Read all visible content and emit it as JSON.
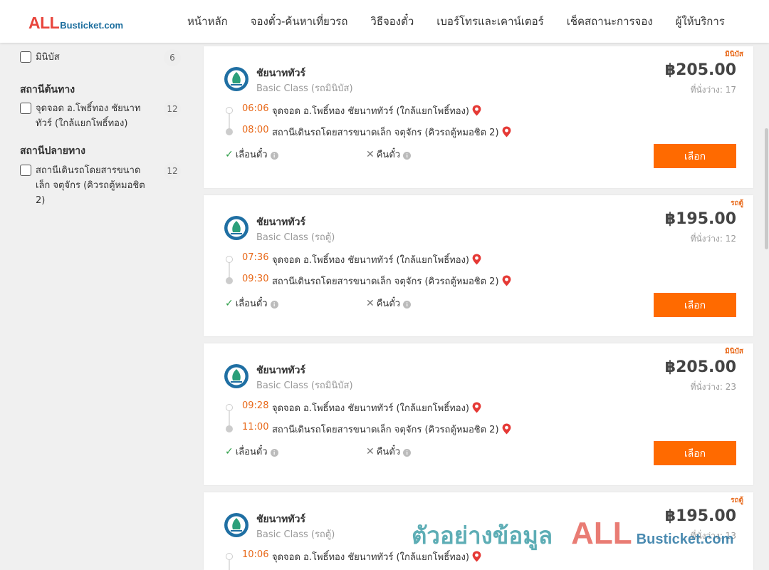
{
  "header": {
    "logo_all": "ALL",
    "logo_busticket": "Busticket.com",
    "nav": [
      {
        "label": "หน้าหลัก"
      },
      {
        "label": "จองตั๋ว-ค้นหาเที่ยวรถ"
      },
      {
        "label": "วิธีจองตั๋ว"
      },
      {
        "label": "เบอร์โทรและเคาน์เตอร์"
      },
      {
        "label": "เช็คสถานะการจอง"
      },
      {
        "label": "ผู้ให้บริการ"
      }
    ]
  },
  "sidebar": {
    "bus_type": {
      "label": "มินิบัส",
      "count": "6"
    },
    "origin": {
      "title": "สถานีต้นทาง",
      "label": "จุดจอด อ.โพธิ์ทอง ชัยนาททัวร์ (ใกล้แยกโพธิ์ทอง)",
      "count": "12"
    },
    "destination": {
      "title": "สถานีปลายทาง",
      "label": "สถานีเดินรถโดยสารขนาดเล็ก จตุจักร (คิวรถตู้หมอชิต 2)",
      "count": "12"
    }
  },
  "trips": [
    {
      "type_tag": "มินิบัส",
      "company": "ชัยนาททัวร์",
      "bus_class": "Basic Class (รถมินิบัส)",
      "price": "฿205.00",
      "seats": "ที่นั่งว่าง: 17",
      "depart_time": "06:06",
      "depart_station": "จุดจอด อ.โพธิ์ทอง ชัยนาททัวร์ (ใกล้แยกโพธิ์ทอง)",
      "arrive_time": "08:00",
      "arrive_station": "สถานีเดินรถโดยสารขนาดเล็ก จตุจักร (คิวรถตู้หมอชิต 2)",
      "reschedule": "เลื่อนตั๋ว",
      "refund": "คืนตั๋ว",
      "select": "เลือก"
    },
    {
      "type_tag": "รถตู้",
      "company": "ชัยนาททัวร์",
      "bus_class": "Basic Class (รถตู้)",
      "price": "฿195.00",
      "seats": "ที่นั่งว่าง: 12",
      "depart_time": "07:36",
      "depart_station": "จุดจอด อ.โพธิ์ทอง ชัยนาททัวร์ (ใกล้แยกโพธิ์ทอง)",
      "arrive_time": "09:30",
      "arrive_station": "สถานีเดินรถโดยสารขนาดเล็ก จตุจักร (คิวรถตู้หมอชิต 2)",
      "reschedule": "เลื่อนตั๋ว",
      "refund": "คืนตั๋ว",
      "select": "เลือก"
    },
    {
      "type_tag": "มินิบัส",
      "company": "ชัยนาททัวร์",
      "bus_class": "Basic Class (รถมินิบัส)",
      "price": "฿205.00",
      "seats": "ที่นั่งว่าง: 23",
      "depart_time": "09:28",
      "depart_station": "จุดจอด อ.โพธิ์ทอง ชัยนาททัวร์ (ใกล้แยกโพธิ์ทอง)",
      "arrive_time": "11:00",
      "arrive_station": "สถานีเดินรถโดยสารขนาดเล็ก จตุจักร (คิวรถตู้หมอชิต 2)",
      "reschedule": "เลื่อนตั๋ว",
      "refund": "คืนตั๋ว",
      "select": "เลือก"
    },
    {
      "type_tag": "รถตู้",
      "company": "ชัยนาททัวร์",
      "bus_class": "Basic Class (รถตู้)",
      "price": "฿195.00",
      "seats": "ที่นั่งว่าง: 13",
      "depart_time": "10:06",
      "depart_station": "จุดจอด อ.โพธิ์ทอง ชัยนาททัวร์ (ใกล้แยกโพธิ์ทอง)"
    }
  ],
  "watermark": {
    "text": "ตัวอย่างข้อมูล",
    "all": "ALL",
    "busticket": "Busticket.com"
  },
  "colors": {
    "accent_orange": "#ff6a00",
    "time_orange": "#e8691a",
    "logo_red": "#e8453c",
    "logo_blue": "#1c6e9e",
    "check_green": "#2e9e48",
    "pin_red": "#e53935"
  },
  "icons": {
    "company_logo": "chainat-tour-logo-icon",
    "location": "map-pin-icon",
    "allowed": "check-icon",
    "not_allowed": "close-icon",
    "info": "info-icon"
  }
}
